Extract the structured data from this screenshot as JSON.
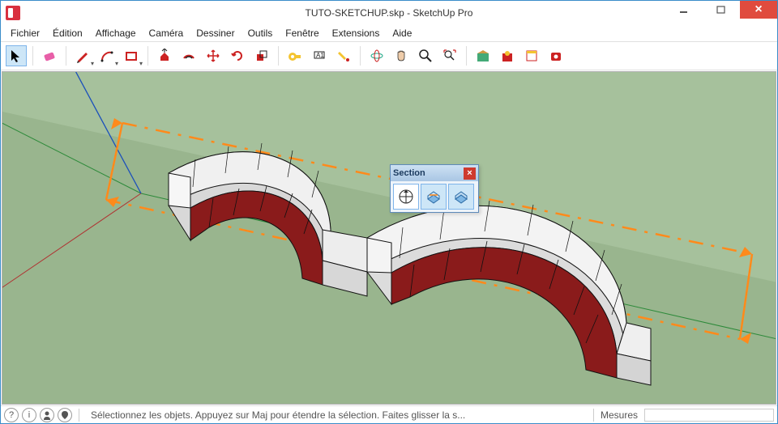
{
  "window": {
    "title": "TUTO-SKETCHUP.skp - SketchUp Pro"
  },
  "menu": {
    "items": [
      "Fichier",
      "Édition",
      "Affichage",
      "Caméra",
      "Dessiner",
      "Outils",
      "Fenêtre",
      "Extensions",
      "Aide"
    ]
  },
  "palette": {
    "title": "Section"
  },
  "status": {
    "hint": "Sélectionnez les objets. Appuyez sur Maj pour étendre la sélection. Faites glisser la s...",
    "measures_label": "Mesures",
    "measures_value": ""
  }
}
